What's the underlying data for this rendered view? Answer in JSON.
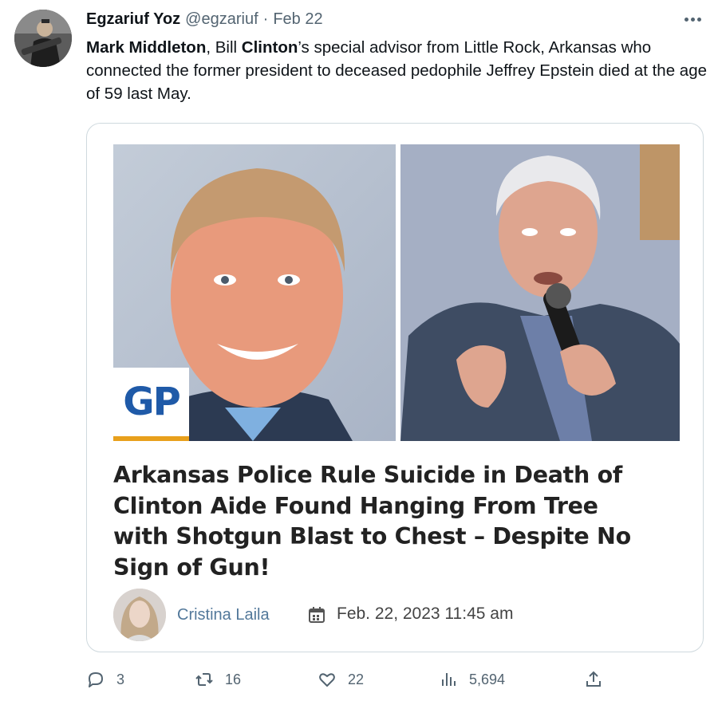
{
  "tweet": {
    "display_name": "Egzariuf Yoz",
    "handle": "@egzariuf",
    "separator": "·",
    "date": "Feb 22",
    "text": {
      "bold1": "Mark Middleton",
      "part1": ", Bill ",
      "bold2": "Clinton",
      "part2": "’s special advisor from Little Rock, Arkansas who connected the former president to deceased pedophile Jeffrey Epstein died at the age of 59 last May."
    }
  },
  "card": {
    "badge": "GP",
    "headline": "Arkansas Police Rule Suicide in Death of Clinton Aide Found Hanging From Tree with Shotgun Blast to Chest – Despite No Sign of Gun!",
    "author": "Cristina Laila",
    "post_date": "Feb. 22, 2023 11:45 am"
  },
  "actions": {
    "replies": "3",
    "retweets": "16",
    "likes": "22",
    "views": "5,694"
  },
  "icons": {
    "more": "more-icon",
    "reply": "reply-icon",
    "retweet": "retweet-icon",
    "like": "heart-icon",
    "views": "views-icon",
    "share": "share-icon",
    "calendar": "calendar-icon"
  },
  "colors": {
    "secondary_text": "#536471",
    "author_link": "#52789a",
    "gp_blue": "#1f5aa8",
    "gp_accent": "#e8a01c"
  }
}
